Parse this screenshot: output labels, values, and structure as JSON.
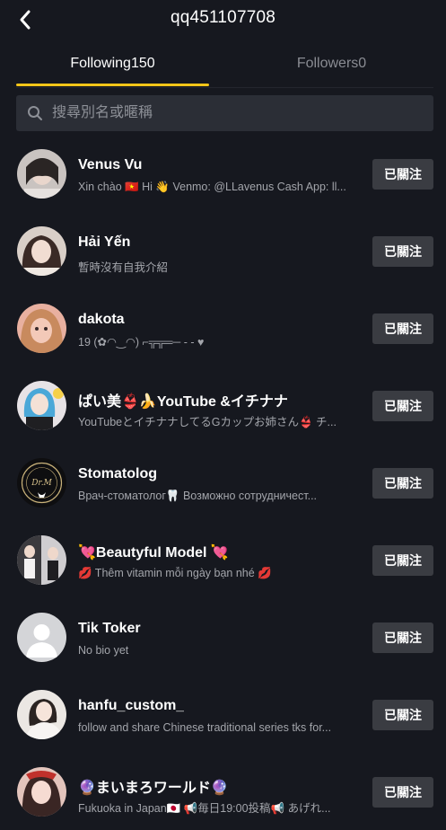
{
  "header": {
    "title": "qq451107708"
  },
  "tabs": {
    "following": "Following150",
    "followers": "Followers0"
  },
  "search": {
    "placeholder": "搜尋別名或暱稱"
  },
  "follow_label": "已關注",
  "colors": {
    "background": "#16181f",
    "tab_accent": "#f5c518",
    "button_bg": "#3a3c42"
  },
  "users": [
    {
      "name": "Venus Vu",
      "bio": "Xin chào 🇻🇳 Hi 👋 Venmo: @LLavenus Cash App: ll..."
    },
    {
      "name": "Hải Yến",
      "bio": "暫時沒有自我介紹"
    },
    {
      "name": "dakota",
      "bio": "19 (✿◠‿◠) ⌐╦╦═─ - - ♥"
    },
    {
      "name": "ぱい美👙🍌YouTube &イチナナ",
      "bio": "YouTubeとイチナナしてるGカップお姉さん👙 チ..."
    },
    {
      "name": "Stomatolog",
      "bio": "Врач-стоматолог🦷 Возможно сотрудничест..."
    },
    {
      "name": "💘Beautyful Model 💘",
      "bio": "💋 Thêm vitamin mỗi ngày bạn nhé 💋"
    },
    {
      "name": "Tik Toker",
      "bio": "No bio yet"
    },
    {
      "name": "hanfu_custom_",
      "bio": "follow and share Chinese traditional series  tks for..."
    },
    {
      "name": "🔮まいまろワールド🔮",
      "bio": "Fukuoka in Japan🇯🇵 📢毎日19:00投稿📢 あげれ..."
    }
  ]
}
